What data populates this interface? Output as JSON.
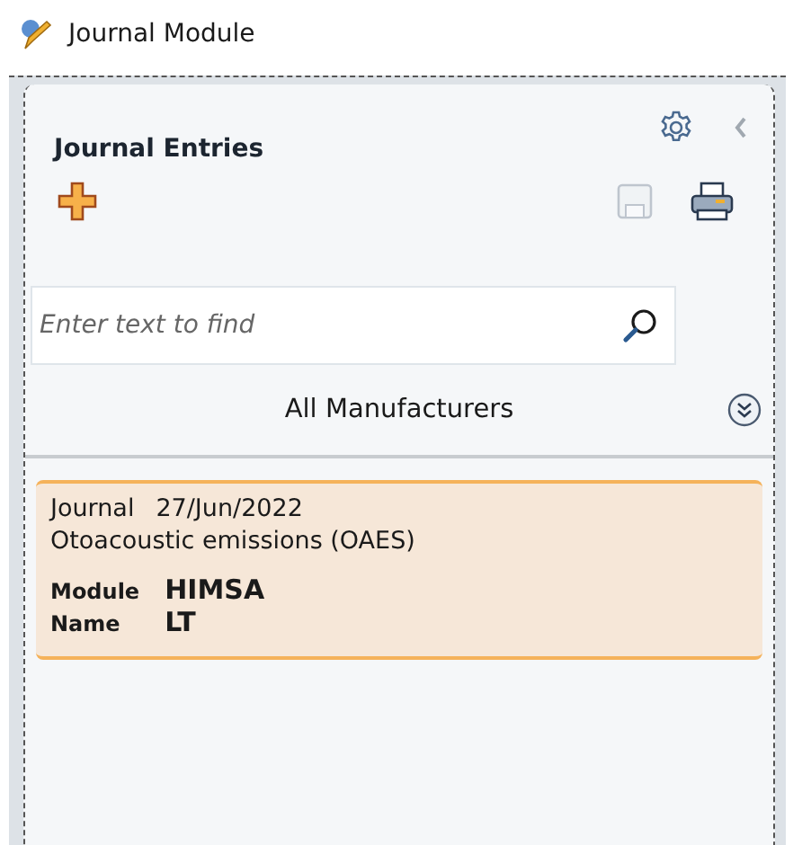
{
  "window": {
    "title": "Journal Module"
  },
  "panel": {
    "title": "Journal Entries",
    "toolbar": [
      {
        "kind": "add",
        "disabled": false
      },
      {
        "kind": "save",
        "disabled": true
      },
      {
        "kind": "print",
        "disabled": false
      }
    ],
    "search": {
      "placeholder": "Enter text to find"
    },
    "filter": "All Manufacturers",
    "entries": [
      {
        "type": "Journal",
        "date": "27/Jun/2022",
        "description": "Otoacoustic emissions (OAES)",
        "selected": true,
        "fields": [
          {
            "label": "Module",
            "value": "HIMSA"
          },
          {
            "label": "Name",
            "value": "LT"
          }
        ]
      }
    ]
  }
}
